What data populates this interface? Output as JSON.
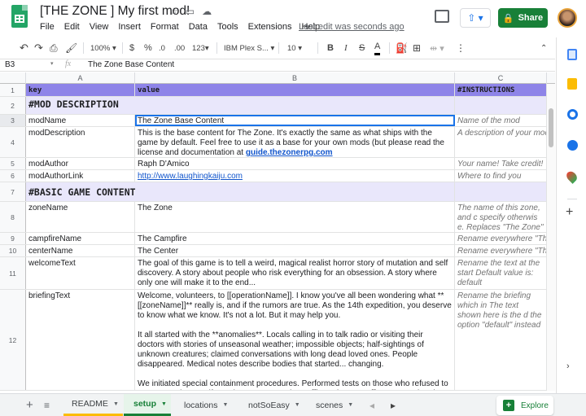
{
  "app": {
    "doc_title": "[THE ZONE ] My first mod!",
    "menus": [
      "File",
      "Edit",
      "View",
      "Insert",
      "Format",
      "Data",
      "Tools",
      "Extensions",
      "Help"
    ],
    "last_edit": "Last edit was seconds ago",
    "share_label": "Share"
  },
  "toolbar": {
    "zoom": "100%",
    "currency": "$",
    "percent": "%",
    "dec_decrease": ".0",
    "dec_increase": ".00",
    "format_more": "123",
    "font": "IBM Plex S...",
    "font_size": "10",
    "bold": "B",
    "italic": "I",
    "strike": "S",
    "text_color": "A"
  },
  "formula_bar": {
    "cell_ref": "B3",
    "fx": "fx",
    "value": "The Zone Base Content"
  },
  "columns": [
    "A",
    "B",
    "C"
  ],
  "rows": [
    {
      "n": "1",
      "a": "key",
      "b": "value",
      "c": "#INSTRUCTIONS"
    },
    {
      "n": "2",
      "a": "#MOD DESCRIPTION",
      "b": "",
      "c": ""
    },
    {
      "n": "3",
      "a": "modName",
      "b": "The Zone Base Content",
      "c": "Name of the mod"
    },
    {
      "n": "4",
      "a": "modDescription",
      "b": "This is the base content for The Zone. It's exactly the same as what ships with the game by default. Feel free to use it as a base for your own mods (but please read the license and documentation at",
      "b_link": "guide.thezonerpg.com",
      "c": "A description of your mod"
    },
    {
      "n": "5",
      "a": "modAuthor",
      "b": "Raph D'Amico",
      "c": "Your name! Take credit!"
    },
    {
      "n": "6",
      "a": "modAuthorLink",
      "b": "http://www.laughingkaiju.com",
      "c": "Where to find you"
    },
    {
      "n": "7",
      "a": "#BASIC GAME CONTENT",
      "b": "",
      "c": ""
    },
    {
      "n": "8",
      "a": "zoneName",
      "b": "The Zone",
      "c": "The name of this zone, and c specify otherwise. Replaces \"The Zone\""
    },
    {
      "n": "9",
      "a": "campfireName",
      "b": "The Campfire",
      "c": "Rename everywhere \"The Ca"
    },
    {
      "n": "10",
      "a": "centerName",
      "b": "The Center",
      "c": "Rename everywhere \"The Ce"
    },
    {
      "n": "11",
      "a": "welcomeText",
      "b": "The goal of this game is to tell a weird, magical realist horror story of mutation and self discovery. A story about people who risk everything for an obsession. A story where only one will make it to the end...",
      "c": "Rename the text at the start Default value is: default"
    },
    {
      "n": "12",
      "a": "briefingText",
      "b": "Welcome, volunteers, to [[operationName]]. I know you've all been wondering what **[[zoneName]]** really is, and if the rumors are true. As the 14th expedition, you deserve to know what we know. It's not a lot. But it may help you.",
      "b2": "It all started with the **anomalies**. Locals calling in to talk radio or visiting their doctors with stories of unseasonal weather; impossible objects; half-sightings of unknown creatures; claimed conversations with long dead loved ones. People disappeared. Medical notes describe bodies that started... changing.",
      "b3": "We initiated special containment procedures. Performed tests on those who refused to evacuate. Then, as if reacting to our attention, **[[boundaryName]]** appeared and isolated",
      "c": "Rename the briefing which in The text shown here is the d the option \"default\" instead"
    }
  ],
  "sheet_tabs": [
    "README",
    "setup",
    "locations",
    "notSoEasy",
    "scenes"
  ],
  "active_tab": "setup",
  "explore_label": "Explore"
}
